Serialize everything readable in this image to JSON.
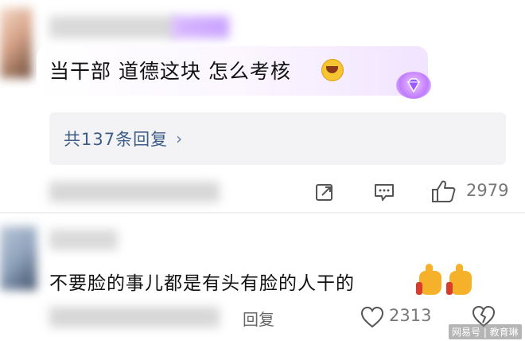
{
  "comments": [
    {
      "text": "当干部 道德这块 怎么考核",
      "replies_label": "共137条回复",
      "replies_arrow": "›",
      "likes": "2979"
    },
    {
      "text": "不要脸的事儿都是有头有脸的人干的",
      "reply_label": "回复",
      "likes": "2313"
    }
  ],
  "icons": {
    "share": "share-icon",
    "comment": "comment-icon",
    "like": "thumbs-up-icon",
    "heart": "heart-icon",
    "dislike": "broken-heart-icon",
    "emoji_laugh": "laughing-crying-emoji",
    "emoji_thumb": "thumbs-up-emoji",
    "gem": "diamond-badge-icon"
  },
  "watermark": "网易号 | 教育琳",
  "colors": {
    "link": "#3d5d86",
    "replies_bg": "#f3f3f5",
    "meta_text": "#777777"
  }
}
